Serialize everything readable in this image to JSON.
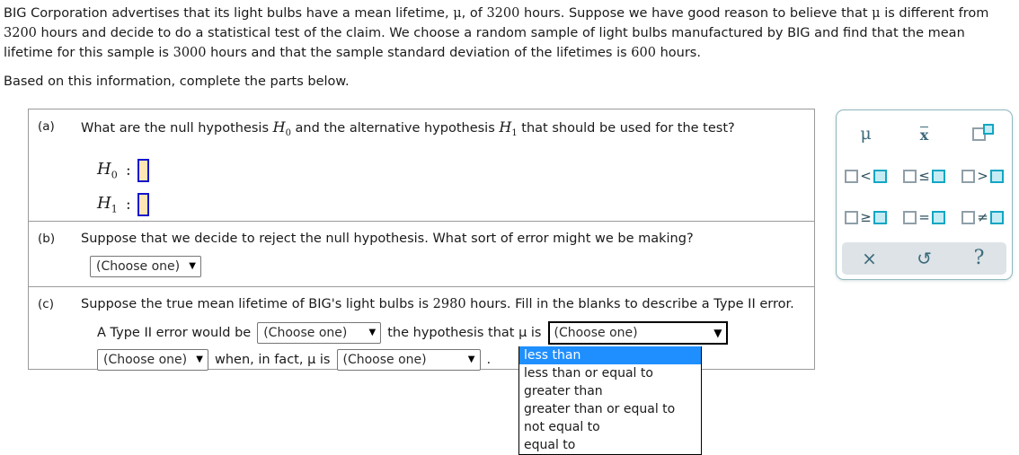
{
  "intro": {
    "paragraph1": "BIG Corporation advertises that its light bulbs have a mean lifetime, μ, of 3200 hours. Suppose we have good reason to believe that μ is different from 3200 hours and decide to do a statistical test of the claim. We choose a random sample of light bulbs manufactured by BIG and find that the mean lifetime for this sample is 3000 hours and that the sample standard deviation of the lifetimes is 600 hours.",
    "paragraph2": "Based on this information, complete the parts below."
  },
  "parts": {
    "a": {
      "label": "(a)",
      "question": "What are the null hypothesis H₀ and the alternative hypothesis H₁ that should be used for the test?",
      "question_pre": "What are the null hypothesis ",
      "question_mid": " and the alternative hypothesis ",
      "question_post": " that should be used for the test?",
      "h0_name": "H",
      "h0_sub": "0",
      "h1_name": "H",
      "h1_sub": "1",
      "colon": ":",
      "h0_value": "",
      "h1_value": ""
    },
    "b": {
      "label": "(b)",
      "question": "Suppose that we decide to reject the null hypothesis. What sort of error might we be making?",
      "select_value": "(Choose one)",
      "caret": "▼"
    },
    "c": {
      "label": "(c)",
      "question_pre": "Suppose the true mean lifetime of BIG's light bulbs is ",
      "question_value": "2980",
      "question_post": " hours. Fill in the blanks to describe a Type II error.",
      "line1_lead": "A Type II error would be",
      "line1_mid": "the hypothesis that μ is",
      "line2_mid": "when, in fact, μ is",
      "line2_period": ".",
      "select1_value": "(Choose one)",
      "select2_value": "(Choose one)",
      "select3_value": "(Choose one)",
      "select4_value": "(Choose one)",
      "caret": "▼"
    }
  },
  "dropdown": {
    "open": true,
    "selected_index": 0,
    "highlight_color": "#1f8fff",
    "options": [
      "less than",
      "less than or equal to",
      "greater than",
      "greater than or equal to",
      "not equal to",
      "equal to"
    ]
  },
  "palette": {
    "accent_color": "#3d6b7d",
    "box_fill_color": "#c5ecf4",
    "box_border_color": "#12a6c4",
    "symbols": [
      {
        "name": "mu",
        "glyph": "μ"
      },
      {
        "name": "x-bar",
        "glyph": "x"
      },
      {
        "name": "box-superscript",
        "glyph": ""
      },
      {
        "name": "less-than",
        "operator": "<"
      },
      {
        "name": "less-than-or-equal",
        "operator": "≤"
      },
      {
        "name": "greater-than",
        "operator": ">"
      },
      {
        "name": "greater-than-or-equal",
        "operator": "≥"
      },
      {
        "name": "equals",
        "operator": "="
      },
      {
        "name": "not-equal",
        "operator": "≠"
      }
    ],
    "toolbar": {
      "clear": "×",
      "undo": "↺",
      "help": "?"
    }
  }
}
